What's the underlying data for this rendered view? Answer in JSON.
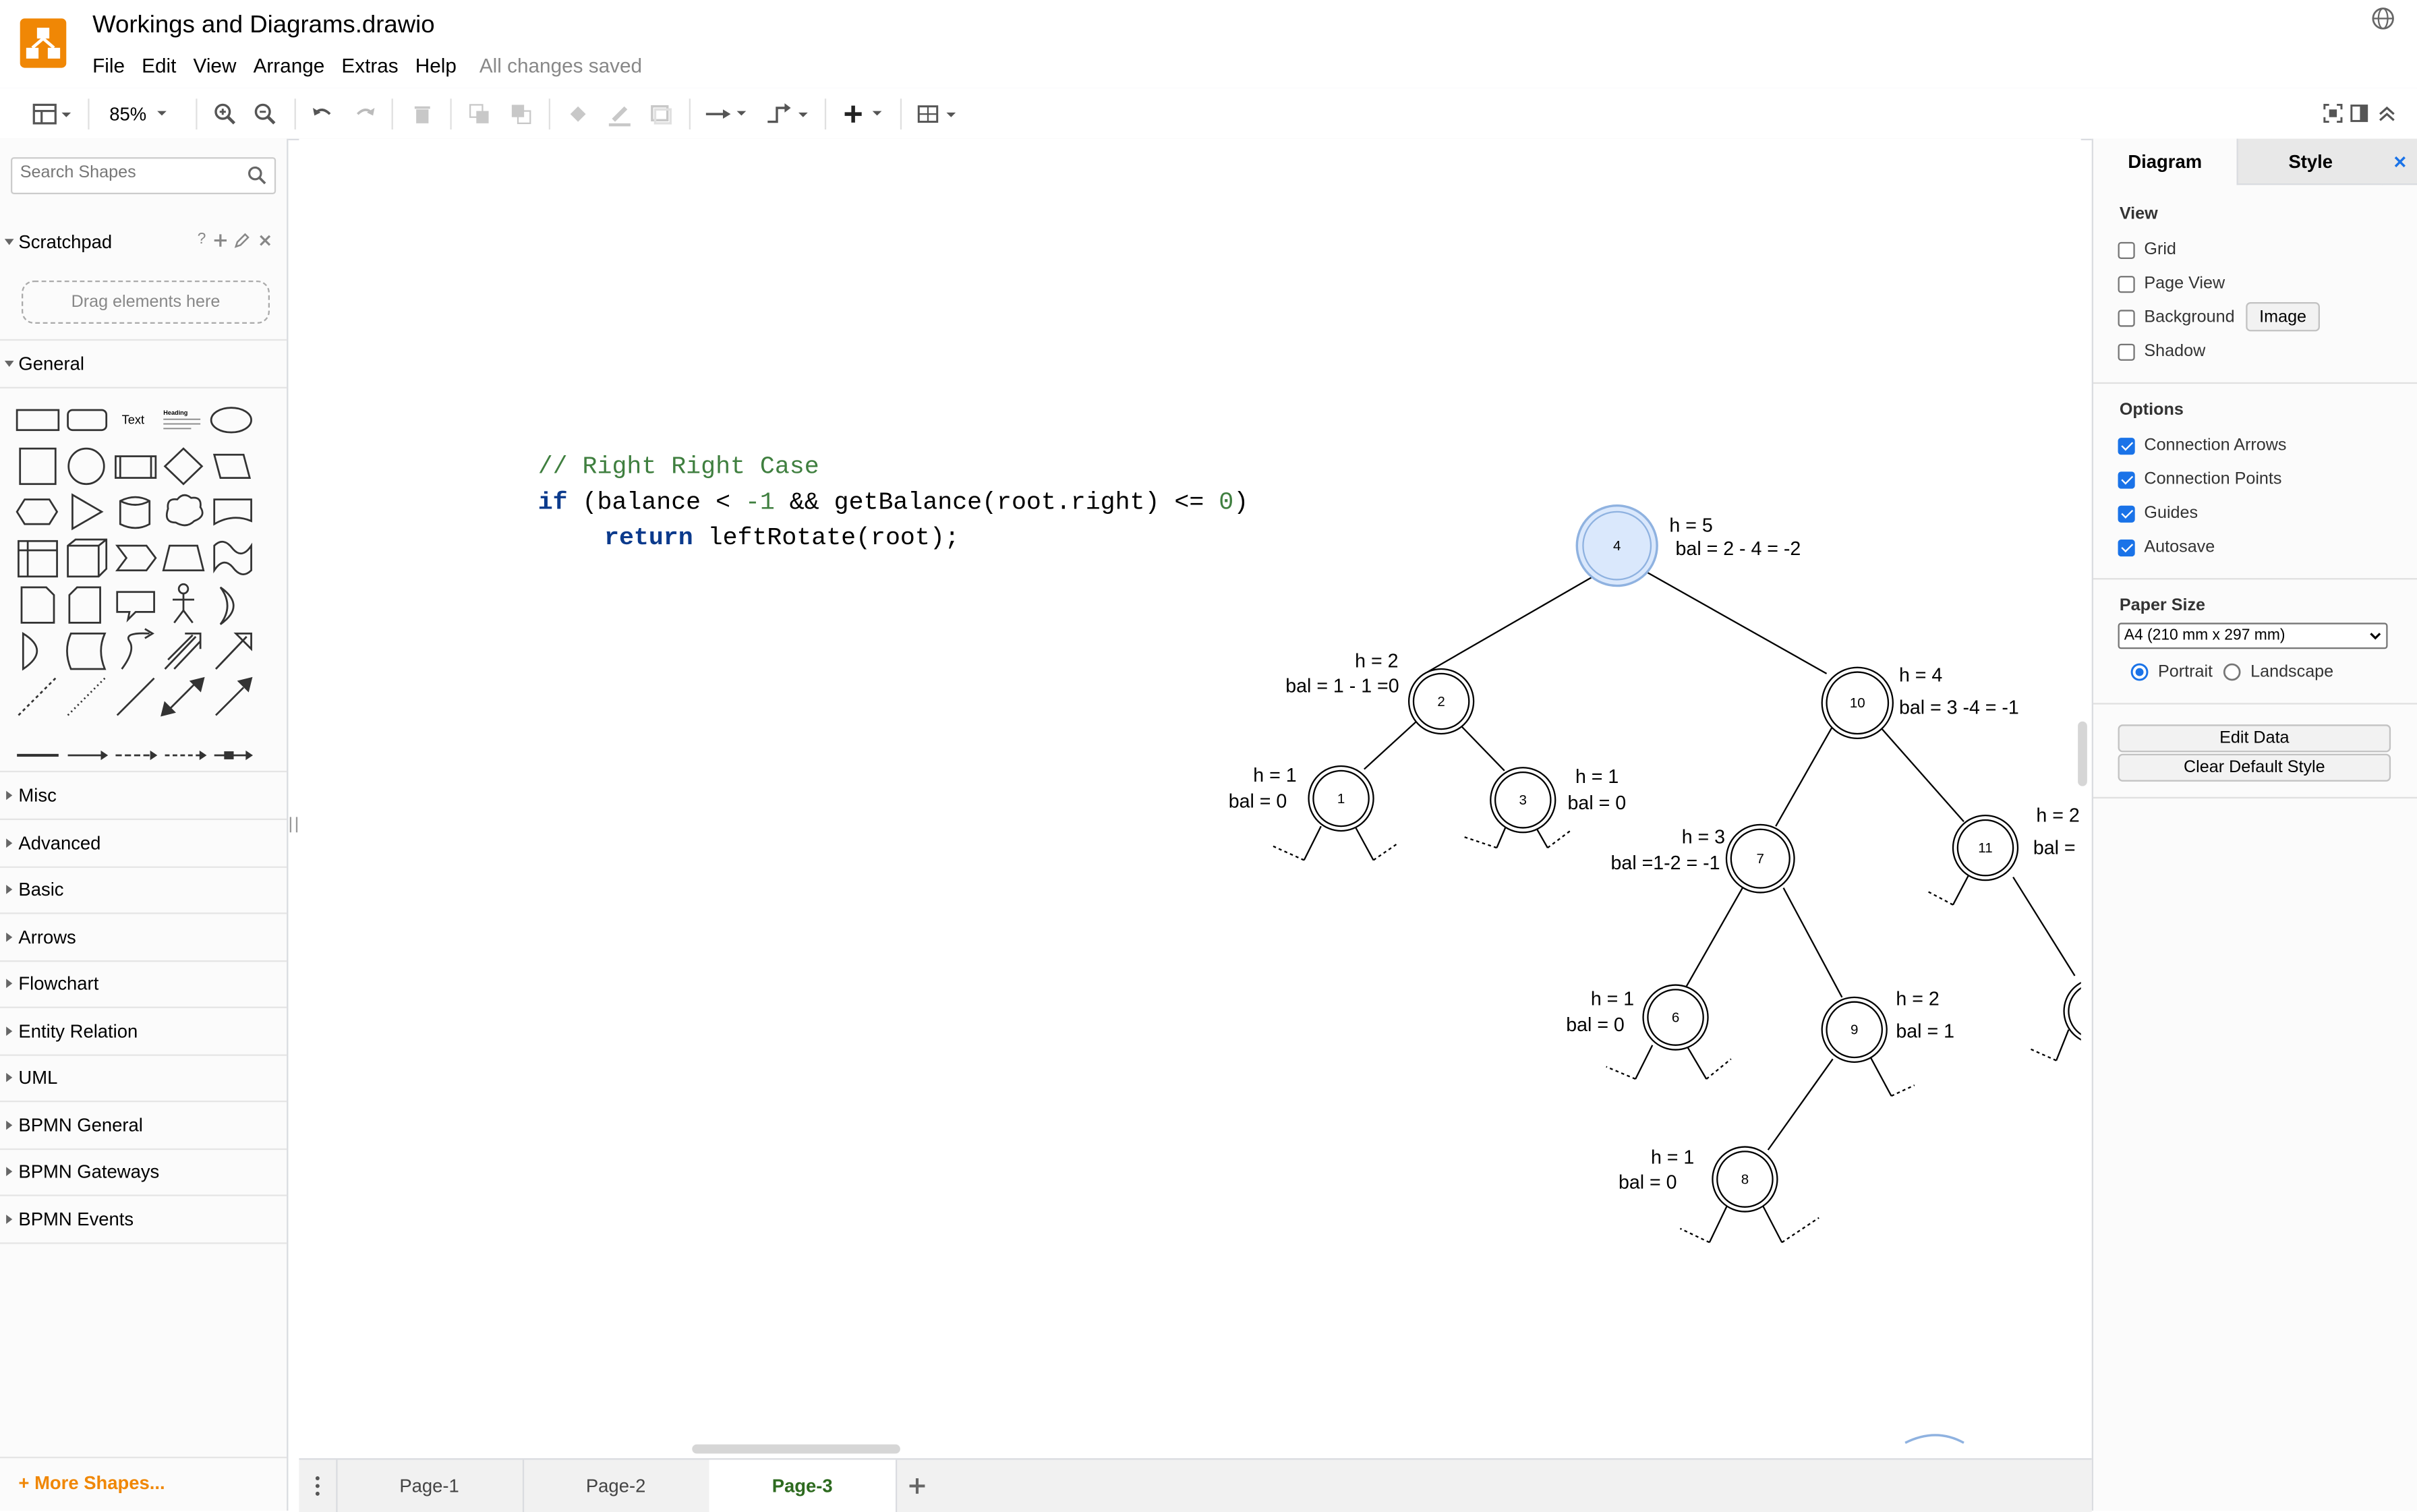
{
  "app": {
    "title": "Workings and Diagrams.drawio",
    "save_status": "All changes saved",
    "menu": [
      "File",
      "Edit",
      "View",
      "Arrange",
      "Extras",
      "Help"
    ],
    "accent_color": "#f08705"
  },
  "toolbar": {
    "zoom": "85%",
    "icons": [
      "format-panel-icon",
      "zoom-in-icon",
      "zoom-out-icon",
      "undo-icon",
      "redo-icon",
      "delete-icon",
      "to-front-icon",
      "to-back-icon",
      "fill-color-icon",
      "line-color-icon",
      "shadow-icon",
      "connection-icon",
      "waypoints-icon",
      "insert-icon",
      "table-icon",
      "fullscreen-icon",
      "format-toggle-icon",
      "collapse-icon"
    ]
  },
  "sidebar": {
    "search_placeholder": "Search Shapes",
    "scratchpad": {
      "label": "Scratchpad",
      "help": "?",
      "drop_hint": "Drag elements here"
    },
    "general": {
      "label": "General",
      "text_shape": "Text",
      "heading_shape": "Heading"
    },
    "sections": [
      "Misc",
      "Advanced",
      "Basic",
      "Arrows",
      "Flowchart",
      "Entity Relation",
      "UML",
      "BPMN General",
      "BPMN Gateways",
      "BPMN Events"
    ],
    "more_shapes": "More Shapes..."
  },
  "canvas": {
    "code": {
      "comment": "// Right Right Case",
      "line2": {
        "kw": "if",
        "a": " (balance < ",
        "n1": "-1",
        "b": " && getBalance(root.right) <= ",
        "n2": "0",
        "c": ")"
      },
      "line3": {
        "kw": "return",
        "rest": " leftRotate(root);"
      }
    },
    "nodes": [
      {
        "id": "n4",
        "label": "4",
        "selected": true
      },
      {
        "id": "n2",
        "label": "2"
      },
      {
        "id": "n10",
        "label": "10"
      },
      {
        "id": "n1",
        "label": "1"
      },
      {
        "id": "n3",
        "label": "3"
      },
      {
        "id": "n7",
        "label": "7"
      },
      {
        "id": "n11",
        "label": "11"
      },
      {
        "id": "n6",
        "label": "6"
      },
      {
        "id": "n9",
        "label": "9"
      },
      {
        "id": "n8",
        "label": "8"
      }
    ],
    "labels": {
      "n4_h": "h = 5",
      "n4_bal": "bal = 2 - 4 = -2",
      "n2_h": "h = 2",
      "n2_bal": "bal = 1 - 1 =0",
      "n10_h": "h = 4",
      "n10_bal": "bal = 3 -4 = -1",
      "n1_h": "h = 1",
      "n1_bal": "bal = 0",
      "n3_h": "h = 1",
      "n3_bal": "bal = 0",
      "n7_h": "h = 3",
      "n7_bal": "bal =1-2 = -1",
      "n11_h": "h = 2",
      "n11_bal": "bal =",
      "n6_h": "h = 1",
      "n6_bal": "bal = 0",
      "n9_h": "h = 2",
      "n9_bal": "bal = 1",
      "n8_h": "h = 1",
      "n8_bal": "bal = 0"
    }
  },
  "format_panel": {
    "tabs": [
      "Diagram",
      "Style"
    ],
    "view": {
      "title": "View",
      "grid": "Grid",
      "grid_checked": false,
      "page_view": "Page View",
      "page_view_checked": false,
      "background": "Background",
      "background_checked": false,
      "image_button": "Image",
      "shadow": "Shadow",
      "shadow_checked": false
    },
    "options": {
      "title": "Options",
      "connection_arrows": "Connection Arrows",
      "connection_arrows_checked": true,
      "connection_points": "Connection Points",
      "connection_points_checked": true,
      "guides": "Guides",
      "guides_checked": true,
      "autosave": "Autosave",
      "autosave_checked": true
    },
    "paper": {
      "title": "Paper Size",
      "selected": "A4 (210 mm x 297 mm)",
      "portrait": "Portrait",
      "portrait_checked": true,
      "landscape": "Landscape"
    },
    "edit_data": "Edit Data",
    "clear_style": "Clear Default Style"
  },
  "pages": {
    "tabs": [
      "Page-1",
      "Page-2",
      "Page-3"
    ],
    "active": "Page-3",
    "active_color": "#2d6a1f"
  }
}
